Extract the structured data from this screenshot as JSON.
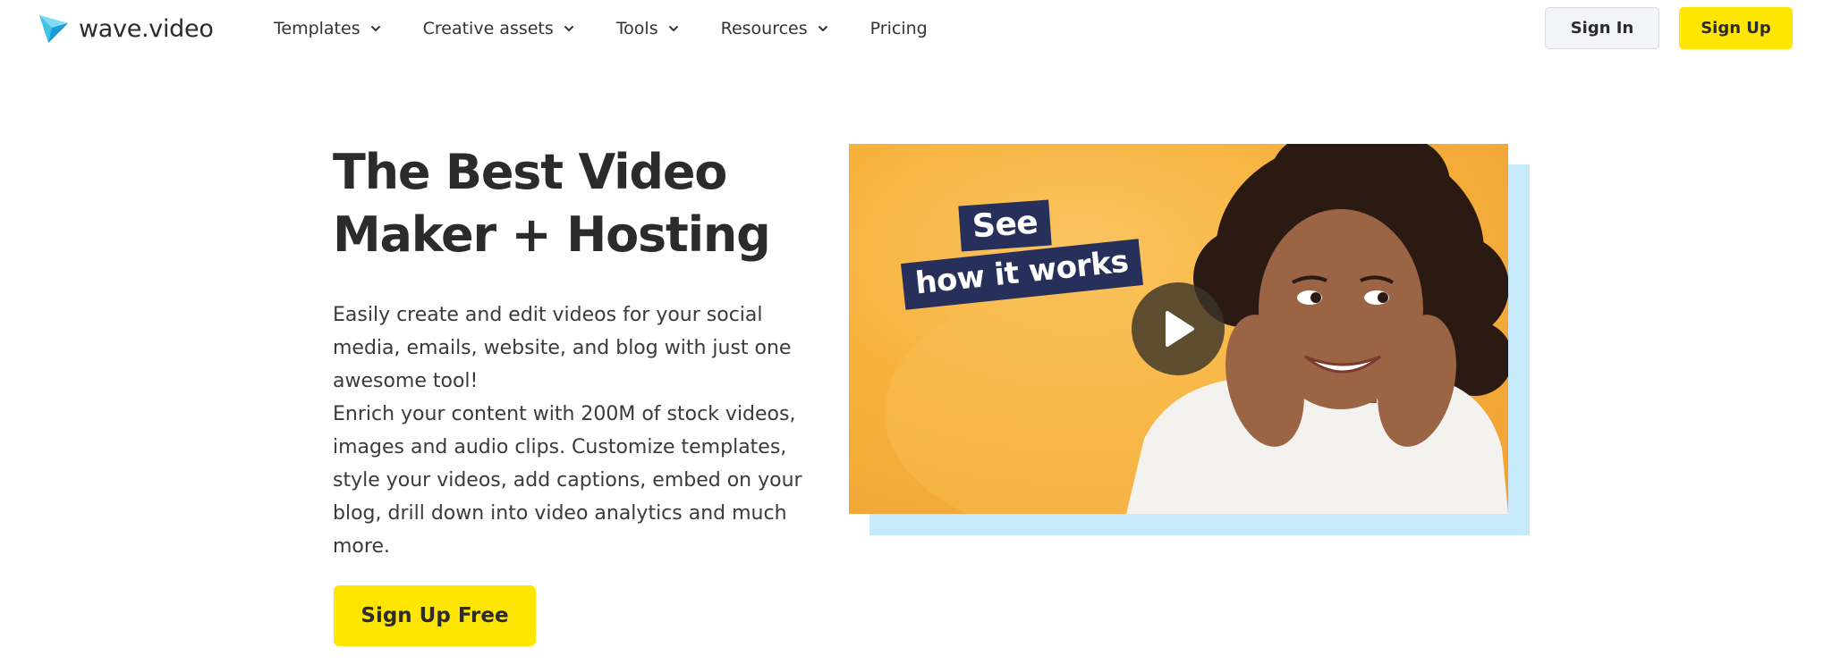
{
  "brand": {
    "name": "wave.video",
    "logo_colors": [
      "#3fc3e8",
      "#1e88c9"
    ]
  },
  "nav": {
    "items": [
      {
        "label": "Templates",
        "has_dropdown": true
      },
      {
        "label": "Creative assets",
        "has_dropdown": true
      },
      {
        "label": "Tools",
        "has_dropdown": true
      },
      {
        "label": "Resources",
        "has_dropdown": true
      },
      {
        "label": "Pricing",
        "has_dropdown": false
      }
    ],
    "sign_in_label": "Sign In",
    "sign_up_label": "Sign Up"
  },
  "hero": {
    "title_line1": "The Best Video",
    "title_line2": "Maker + Hosting",
    "paragraph1": "Easily create and edit videos for your social media, emails, website, and blog with just one awesome tool!",
    "paragraph2": "Enrich your content with 200M of stock videos, images and audio clips. Customize templates, style your videos, add captions, embed on your blog, drill down into video analytics and much more.",
    "cta_label": "Sign Up Free"
  },
  "video": {
    "tag_line1": "See",
    "tag_line2": "how it works",
    "play_icon": "play-icon"
  },
  "colors": {
    "accent_yellow": "#ffe600",
    "video_bg_orange": "#f7b23d",
    "tag_navy": "#27305a",
    "shadow_blue": "#c8e8fb"
  }
}
